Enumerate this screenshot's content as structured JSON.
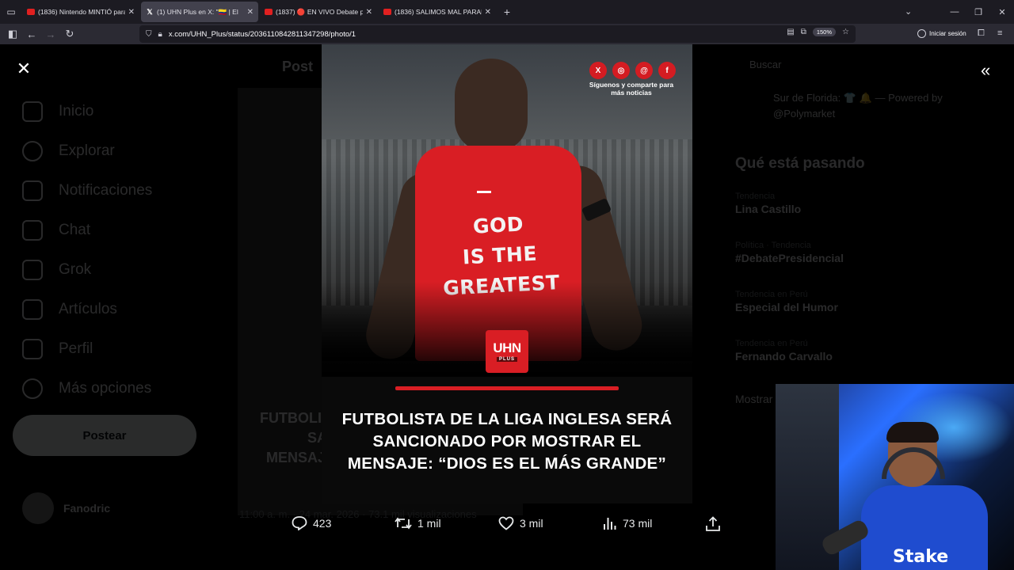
{
  "browser": {
    "tabs": [
      {
        "title": "(1836) Nintendo MINTIÓ para h",
        "favicon": "youtube-icon",
        "active": false
      },
      {
        "title": "(1) UHN Plus en X: \"🇨🇴 | El",
        "favicon": "x-icon",
        "active": true
      },
      {
        "title": "(1837) 🔴 EN VIVO Debate pres",
        "favicon": "youtube-icon",
        "active": false
      },
      {
        "title": "(1836) SALIMOS MAL PARADOS",
        "favicon": "youtube-icon",
        "active": false
      }
    ],
    "url": "x.com/UHN_Plus/status/2036110842811347298/photo/1",
    "zoom": "150%",
    "signin": "Iniciar sesión"
  },
  "background": {
    "sidebar": [
      "Inicio",
      "Explorar",
      "Notificaciones",
      "Chat",
      "Grok",
      "Artículos",
      "Perfil",
      "Más opciones"
    ],
    "post_button": "Postear",
    "profile_name": "Fanodric",
    "post_header": "Post",
    "search": "Buscar",
    "promo": "Sur de Florida: 👕 🔔 — Powered by @Polymarket",
    "trending_title": "Qué está pasando",
    "trends": [
      {
        "category": "Tendencia",
        "name": "Lina Castillo"
      },
      {
        "category": "Política · Tendencia",
        "name": "#DebatePresidencial"
      },
      {
        "category": "Tendencia en Perú",
        "name": "Especial del Humor"
      },
      {
        "category": "Tendencia en Perú",
        "name": "Fernando Carvallo"
      }
    ],
    "show_more": "Mostrar",
    "post_fragment": [
      "FUTBOLIS",
      "SANC",
      "MENSAJ"
    ],
    "post_meta": "11:00 a. m. · 24 mar. 2026 · 73.1 mil visualizaciones"
  },
  "photo": {
    "shirt_lines": [
      "GOD",
      "IS THE",
      "GREATEST"
    ],
    "social_note": "Síguenos y comparte para más noticias",
    "social_icons": [
      "x-icon",
      "instagram-icon",
      "threads-icon",
      "facebook-icon"
    ],
    "logo_top": "UHN",
    "logo_bottom": "PLUS",
    "headline": "FUTBOLISTA DE LA LIGA INGLESA SERÁ SANCIONADO POR MOSTRAR EL MENSAJE: “DIOS ES EL MÁS GRANDE”",
    "accent_color": "#d91e24"
  },
  "actions": {
    "replies": "423",
    "reposts": "1 mil",
    "likes": "3 mil",
    "views": "73 mil"
  },
  "webcam": {
    "sponsor": "Stake"
  }
}
